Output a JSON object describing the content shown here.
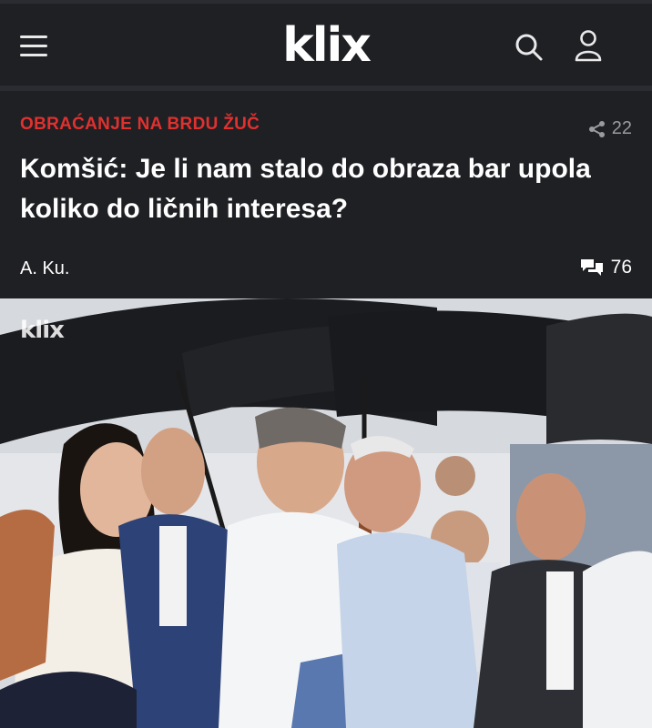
{
  "header": {
    "logo_text": "klix",
    "menu_icon": "hamburger-menu-icon",
    "search_icon": "search-icon",
    "user_icon": "user-icon"
  },
  "article": {
    "category": "OBRAĆANJE NA BRDU ŽUČ",
    "share_count": "22",
    "title": "Komšić: Je li nam stalo do obraza bar upola koliko do ličnih interesa?",
    "author": "A. Ku.",
    "comment_count": "76"
  },
  "photo": {
    "watermark": "klix"
  },
  "colors": {
    "background": "#1f2024",
    "accent": "#e0312f",
    "muted": "#9a9ba0"
  }
}
